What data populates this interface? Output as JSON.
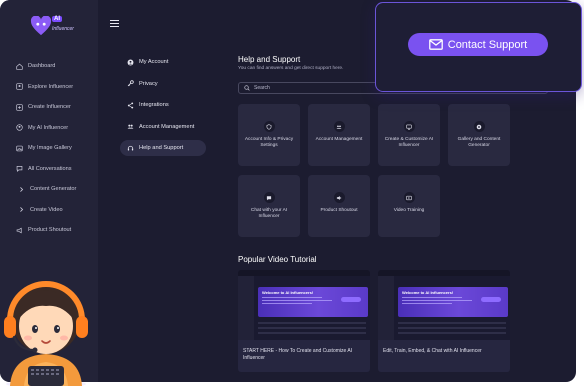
{
  "logo": {
    "badge": "AI",
    "sub": "Influencer"
  },
  "sidebar": {
    "items": [
      {
        "label": "Dashboard",
        "icon": "home-icon"
      },
      {
        "label": "Explore Influencer",
        "icon": "user-search-icon"
      },
      {
        "label": "Create Influencer",
        "icon": "user-plus-icon"
      },
      {
        "label": "My AI Influencer",
        "icon": "profile-icon"
      },
      {
        "label": "My Image Gallery",
        "icon": "image-icon"
      },
      {
        "label": "All Conversations",
        "icon": "chat-icon"
      },
      {
        "label": "Content Generator",
        "icon": "chevron-right-icon"
      },
      {
        "label": "Create Video",
        "icon": "chevron-right-icon"
      },
      {
        "label": "Product Shoutout",
        "icon": "megaphone-icon"
      }
    ]
  },
  "settings": {
    "items": [
      {
        "label": "My Account",
        "icon": "account-icon"
      },
      {
        "label": "Privacy",
        "icon": "key-icon"
      },
      {
        "label": "Integrations",
        "icon": "share-icon"
      },
      {
        "label": "Account Management",
        "icon": "users-icon"
      },
      {
        "label": "Help and Support",
        "icon": "headset-icon",
        "active": true
      }
    ]
  },
  "main": {
    "title": "Help and Support",
    "subtitle": "You can find answers and get direct support here.",
    "search_placeholder": "Search",
    "cards": [
      {
        "label": "Account Info & Privacy Settings",
        "icon": "shield-icon"
      },
      {
        "label": "Account Management",
        "icon": "users-icon"
      },
      {
        "label": "Create & Customize AI Influencer",
        "icon": "screen-icon"
      },
      {
        "label": "Gallery and Content Generator",
        "icon": "gallery-icon"
      },
      {
        "label": "Chat with your AI Influencer",
        "icon": "chat-bubble-icon"
      },
      {
        "label": "Product Shoutout",
        "icon": "speaker-icon"
      },
      {
        "label": "Video Training",
        "icon": "video-icon"
      }
    ],
    "popular_title": "Popular Video Tutorial",
    "videos": [
      {
        "label": "START HERE - How To Create and Customize AI Influencer",
        "thumb_title": "Welcome to AI Influencers!"
      },
      {
        "label": "Edit, Train, Embed, & Chat with AI Influencer",
        "thumb_title": "Welcome to AI Influencers!"
      }
    ]
  },
  "popup": {
    "contact_label": "Contact Support"
  },
  "colors": {
    "accent": "#7a52f0",
    "background": "#1c1c30",
    "sidebar": "#232338",
    "card": "#292940"
  }
}
